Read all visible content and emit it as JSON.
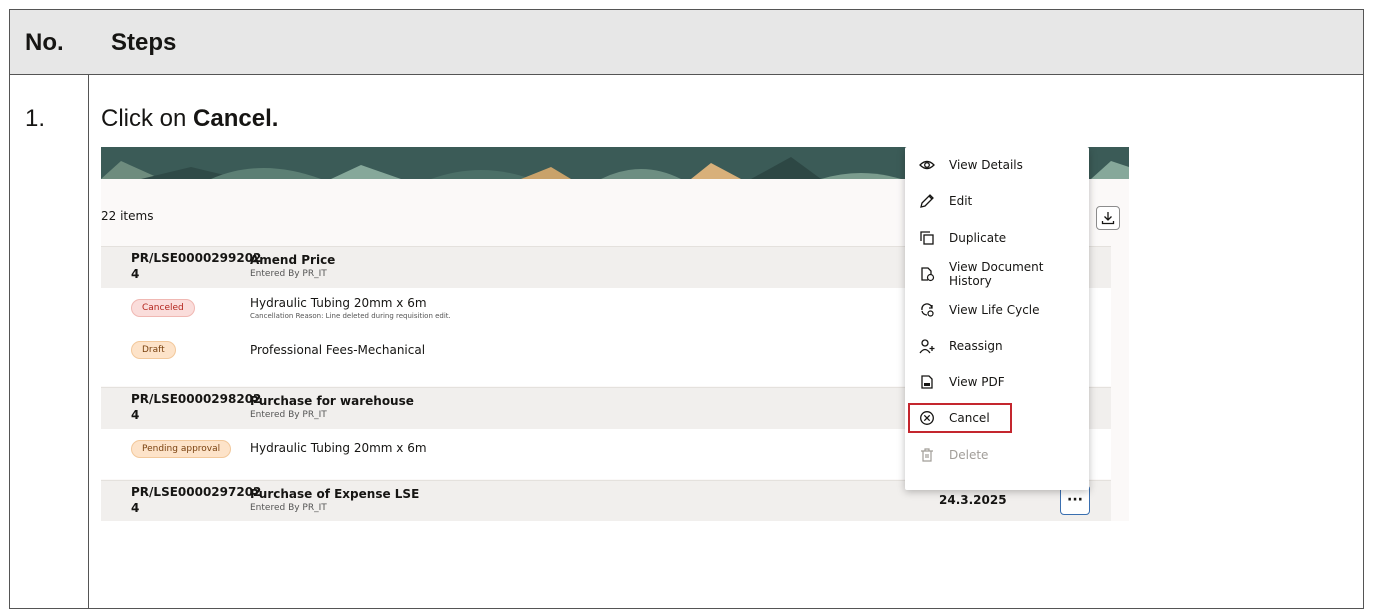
{
  "table": {
    "header_no": "No.",
    "header_steps": "Steps",
    "rows": [
      {
        "number": "1.",
        "instruction_prefix": "Click on ",
        "instruction_bold": "Cancel."
      }
    ]
  },
  "screenshot": {
    "items_count": "22 items",
    "groups": [
      {
        "id": "PR/LSE0000299202 4",
        "title": "Amend Price",
        "entered_by": "Entered By PR_IT",
        "lines": [
          {
            "status": "Canceled",
            "status_color": "#fadddb",
            "description": "Hydraulic Tubing 20mm x 6m",
            "note": "Cancellation Reason: Line deleted during requisition edit."
          },
          {
            "status": "Draft",
            "status_color": "#fde3c9",
            "description": "Professional Fees-Mechanical",
            "note": ""
          }
        ]
      },
      {
        "id": "PR/LSE0000298202 4",
        "title": "Purchase for warehouse",
        "entered_by": "Entered By PR_IT",
        "lines": [
          {
            "status": "Pending approval",
            "status_color": "#fde3c9",
            "description": "Hydraulic Tubing 20mm x 6m",
            "note": ""
          }
        ]
      },
      {
        "id": "PR/LSE0000297202 4",
        "title": "Purchase of Expense LSE",
        "entered_by": "Entered By PR_IT",
        "date": "24.3.2025",
        "more_label": "···",
        "lines": []
      }
    ],
    "menu": [
      {
        "label": "View Details",
        "icon": "eye-icon"
      },
      {
        "label": "Edit",
        "icon": "pencil-icon"
      },
      {
        "label": "Duplicate",
        "icon": "duplicate-icon"
      },
      {
        "label": "View Document History",
        "icon": "document-history-icon"
      },
      {
        "label": "View Life Cycle",
        "icon": "life-cycle-icon"
      },
      {
        "label": "Reassign",
        "icon": "reassign-user-icon"
      },
      {
        "label": "View PDF",
        "icon": "pdf-icon"
      },
      {
        "label": "Cancel",
        "icon": "cancel-circle-icon",
        "highlighted": true
      },
      {
        "label": "Delete",
        "icon": "trash-icon",
        "disabled": true
      }
    ],
    "highlight_color": "#c4262e"
  }
}
